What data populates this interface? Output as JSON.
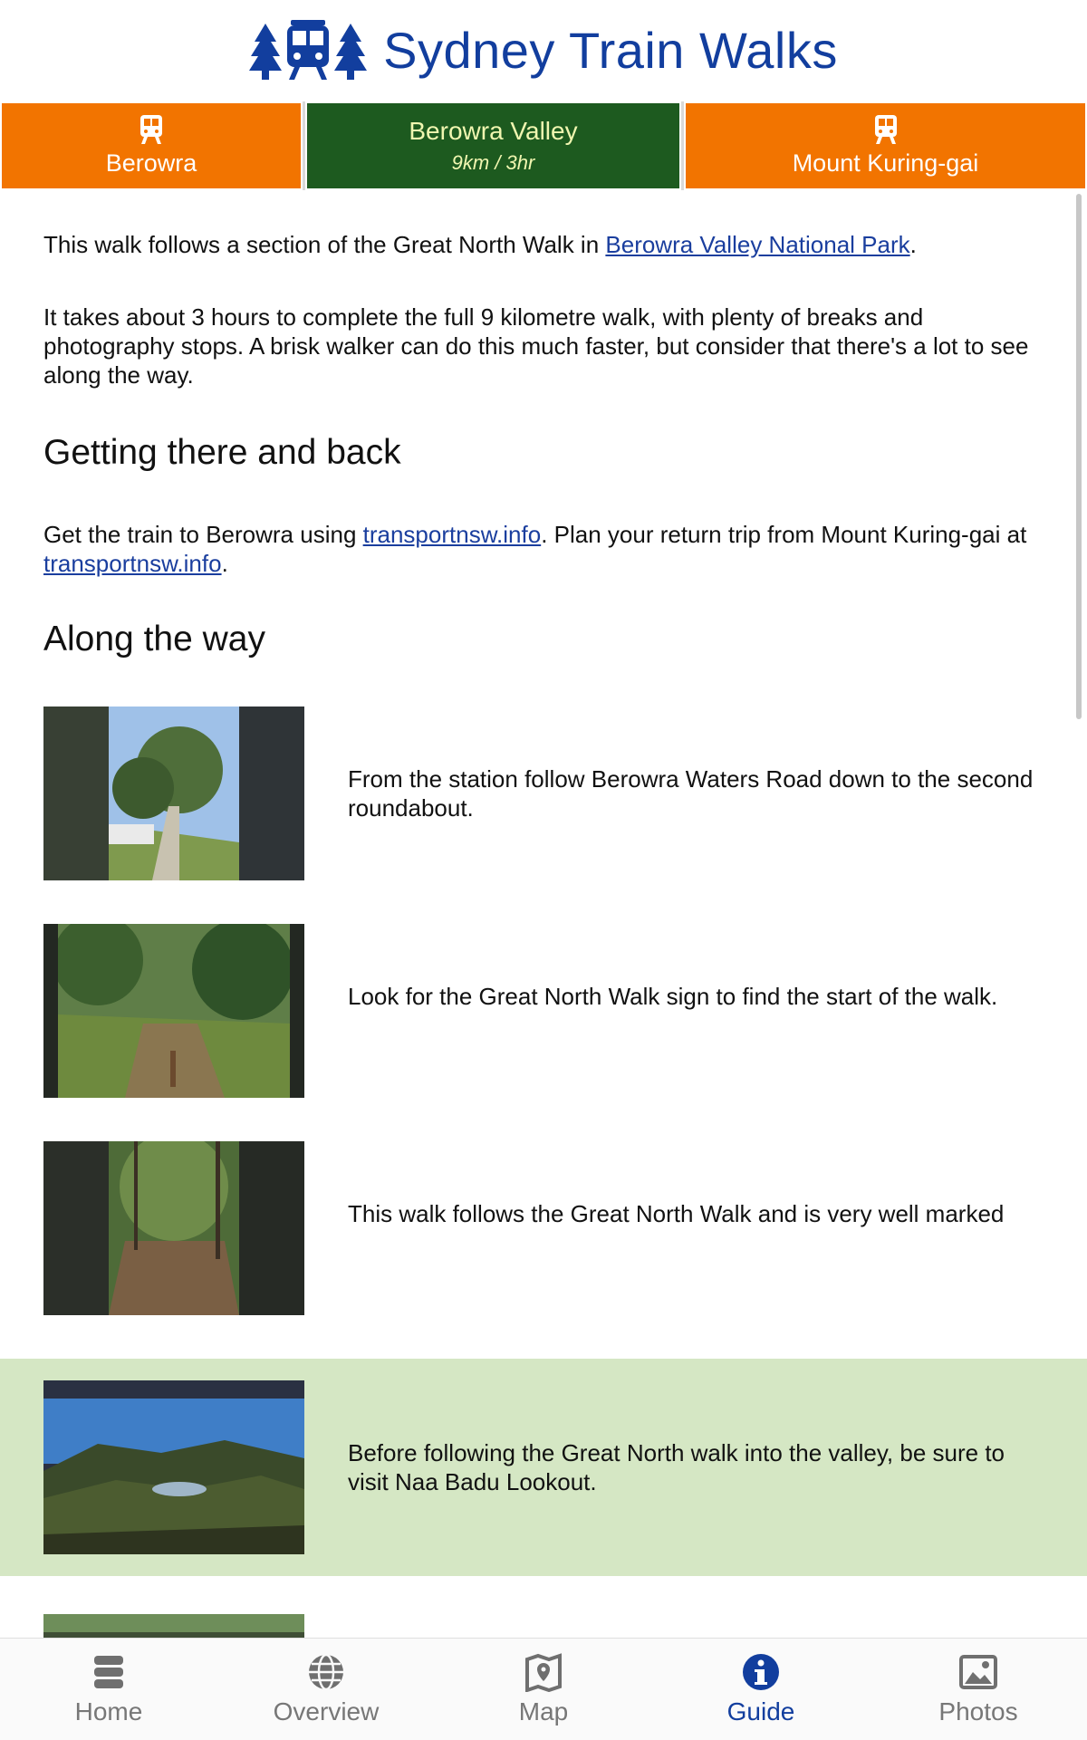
{
  "header": {
    "title": "Sydney Train Walks",
    "logo_icons": [
      "tree-icon",
      "train-icon",
      "tree-icon"
    ],
    "title_color": "#123e9e"
  },
  "route": {
    "start": {
      "icon": "train-icon",
      "name": "Berowra"
    },
    "walk": {
      "name": "Berowra Valley",
      "stats": "9km / 3hr"
    },
    "end": {
      "icon": "train-icon",
      "name": "Mount Kuring-gai"
    },
    "colors": {
      "station": "#f27400",
      "walk": "#1d5a1f",
      "walk_text": "#f0f6b0"
    }
  },
  "content": {
    "intro1_before": "This walk follows a section of the Great North Walk in ",
    "intro1_link": "Berowra Valley National Park",
    "intro1_after": ".",
    "intro2": "It takes about 3 hours to complete the full 9 kilometre walk, with plenty of breaks and photography stops. A brisk walker can do this much faster, but consider that there's a lot to see along the way.",
    "getting_there_heading": "Getting there and back",
    "getting_there_p1": "Get the train to Berowra using ",
    "getting_there_link1": "transportnsw.info",
    "getting_there_p2": ". Plan your return trip from Mount Kuring-gai at ",
    "getting_there_link2": "transportnsw.info",
    "getting_there_p3": ".",
    "along_heading": "Along the way",
    "steps": [
      {
        "text": "From the station follow Berowra Waters Road down to the second roundabout.",
        "highlight": false
      },
      {
        "text": "Look for the Great North Walk sign to find the start of the walk.",
        "highlight": false
      },
      {
        "text": "This walk follows the Great North Walk and is very well marked",
        "highlight": false
      },
      {
        "text": "Before following the Great North walk into the valley, be sure to visit Naa Badu Lookout.",
        "highlight": true
      }
    ],
    "highlight_color": "#d5e7c4"
  },
  "nav": {
    "items": [
      {
        "label": "Home",
        "icon": "database-icon",
        "active": false
      },
      {
        "label": "Overview",
        "icon": "globe-icon",
        "active": false
      },
      {
        "label": "Map",
        "icon": "map-icon",
        "active": false
      },
      {
        "label": "Guide",
        "icon": "info-icon",
        "active": true
      },
      {
        "label": "Photos",
        "icon": "photo-icon",
        "active": false
      }
    ],
    "active_color": "#123e9e",
    "inactive_color": "#777777"
  }
}
